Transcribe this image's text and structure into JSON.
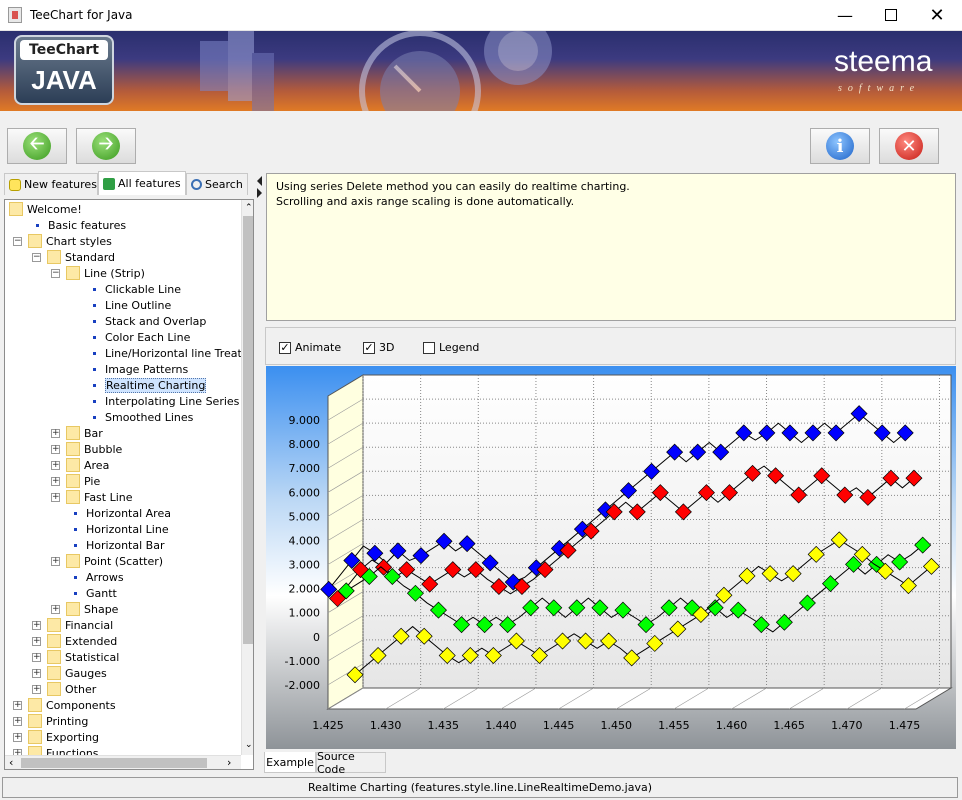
{
  "window": {
    "title": "TeeChart for Java",
    "minimize_icon": "minimize-icon",
    "maximize_icon": "maximize-icon",
    "close_icon": "close-icon"
  },
  "banner": {
    "logo_top": "TeeChart",
    "logo_bottom": "JAVA",
    "brand": "steema",
    "brand_sub": "software"
  },
  "toolbar": {
    "back_icon": "arrow-left-icon",
    "forward_icon": "arrow-right-icon",
    "info_icon": "info-icon",
    "exit_icon": "close-icon"
  },
  "tabs": [
    {
      "label": "New features",
      "icon": "lightbulb-icon"
    },
    {
      "label": "All features",
      "icon": "refresh-icon"
    },
    {
      "label": "Search",
      "icon": "magnifier-icon"
    }
  ],
  "tree": {
    "welcome": "Welcome!",
    "basic": "Basic features",
    "chart_styles": "Chart styles",
    "standard": "Standard",
    "line_strip": "Line (Strip)",
    "line_children": [
      "Clickable Line",
      "Line Outline",
      "Stack and Overlap",
      "Color Each Line",
      "Line/Horizontal line TreatNul",
      "Image Patterns",
      "Realtime Charting",
      "Interpolating Line Series",
      "Smoothed Lines"
    ],
    "standard_children": [
      {
        "label": "Bar",
        "type": "folder"
      },
      {
        "label": "Bubble",
        "type": "folder"
      },
      {
        "label": "Area",
        "type": "folder"
      },
      {
        "label": "Pie",
        "type": "folder"
      },
      {
        "label": "Fast Line",
        "type": "folder"
      },
      {
        "label": "Horizontal Area",
        "type": "leaf"
      },
      {
        "label": "Horizontal Line",
        "type": "leaf"
      },
      {
        "label": "Horizontal Bar",
        "type": "leaf"
      },
      {
        "label": "Point (Scatter)",
        "type": "folder"
      },
      {
        "label": "Arrows",
        "type": "leaf"
      },
      {
        "label": "Gantt",
        "type": "leaf"
      },
      {
        "label": "Shape",
        "type": "folder"
      }
    ],
    "chart_style_groups": [
      "Financial",
      "Extended",
      "Statistical",
      "Gauges",
      "Other"
    ],
    "root_groups": [
      "Components",
      "Printing",
      "Exporting",
      "Functions"
    ],
    "selected": "Realtime Charting"
  },
  "description": {
    "line1": "Using series Delete method you can easily do realtime charting.",
    "line2": "Scrolling and axis range scaling is done automatically."
  },
  "options": {
    "animate": "Animate",
    "animate_checked": true,
    "three_d": "3D",
    "three_d_checked": true,
    "legend": "Legend",
    "legend_checked": false
  },
  "chart_data": {
    "type": "line",
    "title": "",
    "x": [
      1.425,
      1.426,
      1.427,
      1.428,
      1.429,
      1.43,
      1.431,
      1.432,
      1.433,
      1.434,
      1.435,
      1.436,
      1.437,
      1.438,
      1.439,
      1.44,
      1.441,
      1.442,
      1.443,
      1.444,
      1.445,
      1.446,
      1.447,
      1.448,
      1.449,
      1.45,
      1.451,
      1.452,
      1.453,
      1.454,
      1.455,
      1.456,
      1.457,
      1.458,
      1.459,
      1.46,
      1.461,
      1.462,
      1.463,
      1.464,
      1.465,
      1.466,
      1.467,
      1.468,
      1.469,
      1.47,
      1.471,
      1.472,
      1.473,
      1.474,
      1.475
    ],
    "series": [
      {
        "color": "#0000ff",
        "values": [
          2000,
          2600,
          3200,
          3800,
          3500,
          3100,
          3600,
          3200,
          3400,
          3700,
          4000,
          3600,
          3900,
          3500,
          3100,
          2700,
          2300,
          2500,
          2900,
          3300,
          3700,
          4100,
          4500,
          4900,
          5300,
          5700,
          6100,
          6500,
          6900,
          7300,
          7700,
          7300,
          7700,
          8100,
          7700,
          8100,
          8500,
          8200,
          8500,
          8900,
          8500,
          8100,
          8500,
          8900,
          8500,
          8900,
          9300,
          8900,
          8500,
          8100,
          8500
        ]
      },
      {
        "color": "#ff0000",
        "values": [
          1400,
          2000,
          2600,
          3000,
          2700,
          2300,
          2600,
          2300,
          2000,
          2300,
          2600,
          2300,
          2600,
          2200,
          1900,
          1600,
          1900,
          2200,
          2600,
          3000,
          3400,
          3800,
          4200,
          4600,
          5000,
          5400,
          5000,
          5400,
          5800,
          5400,
          5000,
          5400,
          5800,
          5400,
          5800,
          6200,
          6600,
          6900,
          6500,
          6100,
          5700,
          6100,
          6500,
          6100,
          5700,
          6000,
          5600,
          6000,
          6400,
          6000,
          6400
        ]
      },
      {
        "color": "#00ff00",
        "values": [
          1500,
          1800,
          2100,
          2500,
          2100,
          1700,
          1400,
          1000,
          700,
          400,
          100,
          400,
          100,
          400,
          100,
          400,
          800,
          1200,
          800,
          400,
          800,
          1200,
          800,
          400,
          700,
          400,
          100,
          400,
          800,
          1200,
          800,
          400,
          800,
          400,
          700,
          400,
          100,
          -200,
          200,
          600,
          1000,
          1400,
          1800,
          2200,
          2600,
          2200,
          2600,
          3000,
          2700,
          3000,
          3400
        ]
      },
      {
        "color": "#ffff00",
        "values": [
          -2200,
          -1800,
          -1400,
          -1000,
          -600,
          -200,
          -600,
          -1000,
          -1400,
          -1700,
          -1400,
          -1100,
          -1400,
          -1100,
          -800,
          -1100,
          -1400,
          -1100,
          -800,
          -500,
          -800,
          -1100,
          -800,
          -1100,
          -1500,
          -1200,
          -900,
          -600,
          -300,
          0,
          300,
          700,
          1100,
          1500,
          1900,
          2300,
          2000,
          1700,
          2000,
          2400,
          2800,
          3100,
          3400,
          3100,
          2800,
          2400,
          2100,
          1800,
          1500,
          1900,
          2300
        ]
      }
    ],
    "y_ticks": [
      "9.000",
      "8.000",
      "7.000",
      "6.000",
      "5.000",
      "4.000",
      "3.000",
      "2.000",
      "1.000",
      "0",
      "-1.000",
      "-2.000"
    ],
    "x_ticks": [
      "1.425",
      "1.430",
      "1.435",
      "1.440",
      "1.445",
      "1.450",
      "1.455",
      "1.460",
      "1.465",
      "1.470",
      "1.475"
    ],
    "ylim": [
      -3000,
      10000
    ],
    "xlim": [
      1.425,
      1.476
    ],
    "view3d": true,
    "legend": "none"
  },
  "bottom_tabs": [
    "Example",
    "Source Code"
  ],
  "status": "Realtime Charting  (features.style.line.LineRealtimeDemo.java)"
}
